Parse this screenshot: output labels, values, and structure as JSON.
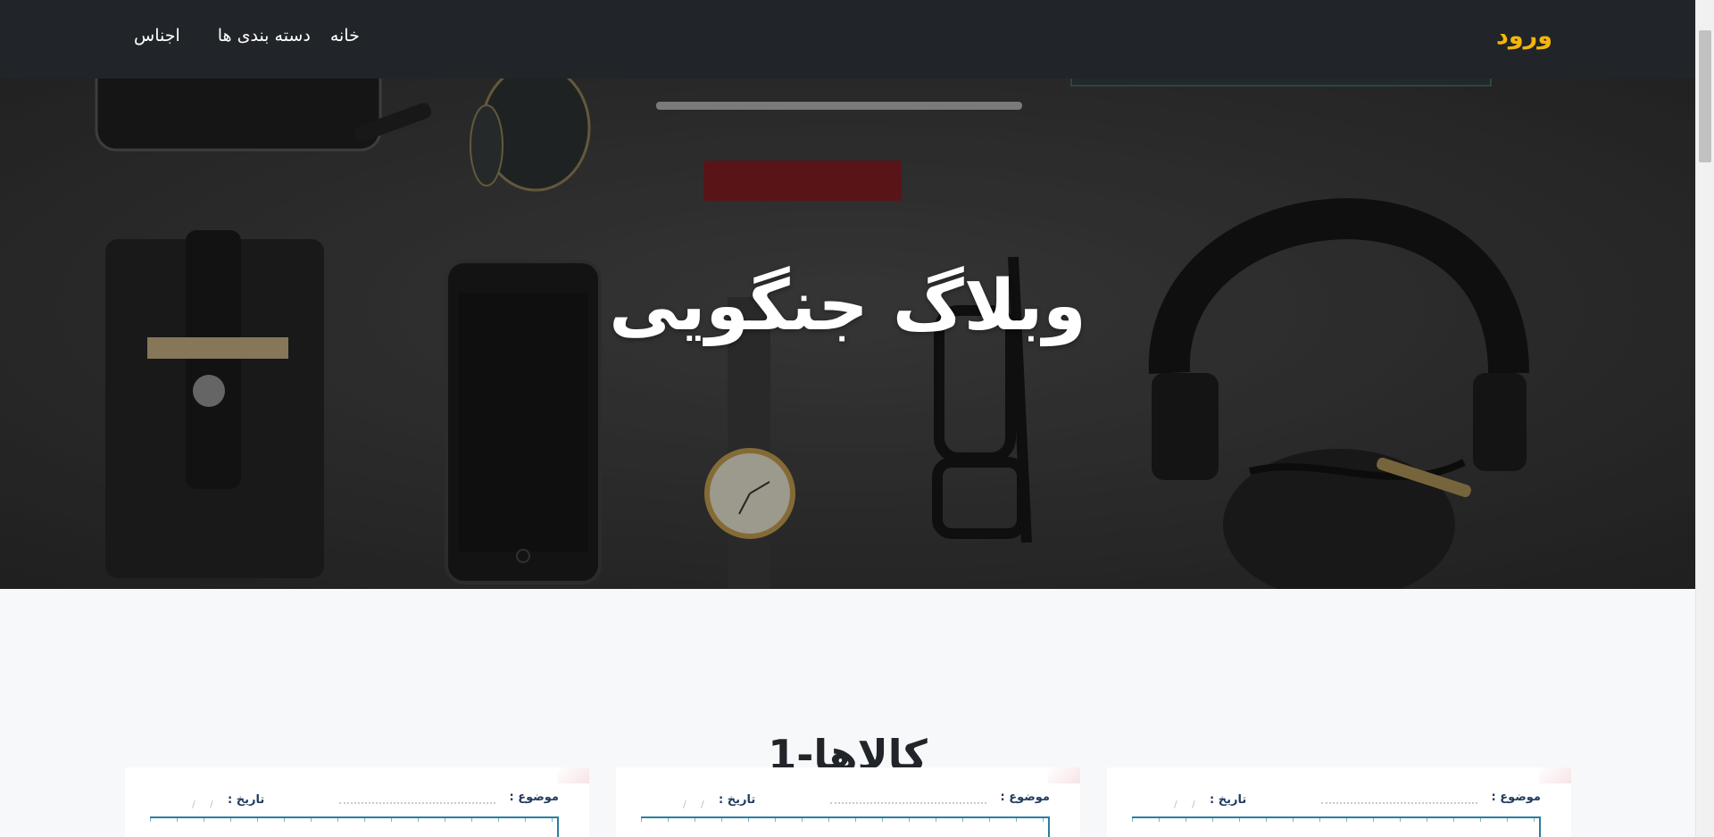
{
  "navbar": {
    "brand": "ورود",
    "links": [
      "خانه",
      "دسته بندی ها",
      "اجناس"
    ]
  },
  "hero": {
    "title": "وبلاگ جنگویی"
  },
  "section": {
    "title": "کالاها-1"
  },
  "cards": [
    {
      "topic_label": "موضوع :",
      "date_label": "تاریخ :"
    },
    {
      "topic_label": "موضوع :",
      "date_label": "تاریخ :"
    },
    {
      "topic_label": "موضوع :",
      "date_label": "تاریخ :"
    }
  ],
  "colors": {
    "navbar_bg": "#212529",
    "brand": "#f5b50a",
    "page_bg": "#f7f8fa",
    "card_accent": "#2b7fa2"
  }
}
